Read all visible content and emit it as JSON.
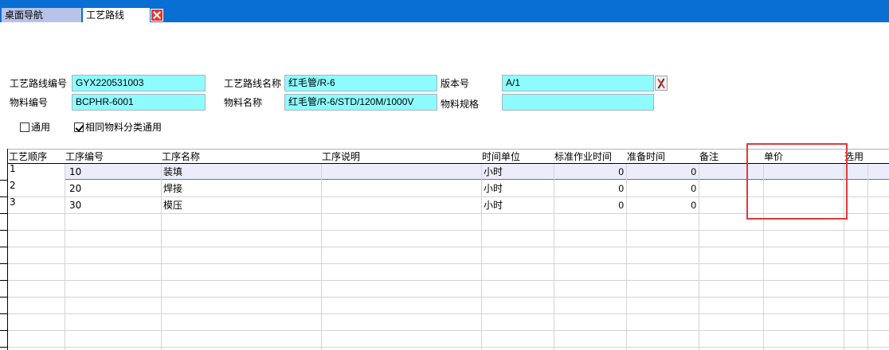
{
  "tabs": [
    {
      "label": "桌面导航"
    },
    {
      "label": "工艺路线"
    }
  ],
  "form": {
    "route_code": {
      "label": "工艺路线编号",
      "value": "GYX220531003"
    },
    "route_name": {
      "label": "工艺路线名称",
      "value": "红毛管/R-6"
    },
    "version": {
      "label": "版本号",
      "value": "A/1"
    },
    "material_code": {
      "label": "物料编号",
      "value": "BCPHR-6001"
    },
    "material_name": {
      "label": "物料名称",
      "value": "红毛管/R-6/STD/120M/1000V"
    },
    "material_spec": {
      "label": "物料规格",
      "value": ""
    },
    "checkbox_general": {
      "label": "通用",
      "checked": false
    },
    "checkbox_same_class": {
      "label": "相同物料分类通用",
      "checked": true
    }
  },
  "grid": {
    "columns": [
      "工艺顺序",
      "工序编号",
      "工序名称",
      "工序说明",
      "时间单位",
      "标准作业时间",
      "准备时间",
      "备注",
      "单价",
      "选用"
    ],
    "rows": [
      {
        "seq": "1",
        "code": "10",
        "name": "装填",
        "desc": "",
        "unit": "小时",
        "std_time": "0",
        "prep_time": "0",
        "remark": "",
        "price": "",
        "use": ""
      },
      {
        "seq": "2",
        "code": "20",
        "name": "焊接",
        "desc": "",
        "unit": "小时",
        "std_time": "0",
        "prep_time": "0",
        "remark": "",
        "price": "",
        "use": ""
      },
      {
        "seq": "3",
        "code": "30",
        "name": "模压",
        "desc": "",
        "unit": "小时",
        "std_time": "0",
        "prep_time": "0",
        "remark": "",
        "price": "",
        "use": ""
      }
    ]
  },
  "colors": {
    "tabbar": "#0a6fd3",
    "field_bg": "#8efcff",
    "highlight": "#e0393a",
    "selected_row": "#ecedfa"
  }
}
